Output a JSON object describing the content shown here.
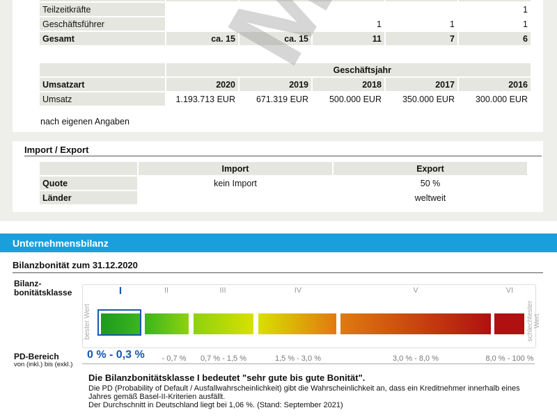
{
  "staff_table": {
    "rows": [
      {
        "label": "Teilzeitkräfte",
        "values": [
          "",
          "",
          "",
          "",
          "1"
        ]
      },
      {
        "label": "Geschäftsführer",
        "values": [
          "",
          "",
          "1",
          "1",
          "1"
        ]
      },
      {
        "label": "Gesamt",
        "values": [
          "ca. 15",
          "ca. 15",
          "11",
          "7",
          "6"
        ]
      }
    ]
  },
  "revenue_table": {
    "group_header": "Geschäftsjahr",
    "col_header": "Umsatzart",
    "years": [
      "2020",
      "2019",
      "2018",
      "2017",
      "2016"
    ],
    "row_label": "Umsatz",
    "values": [
      "1.193.713 EUR",
      "671.319 EUR",
      "500.000 EUR",
      "350.000 EUR",
      "300.000 EUR"
    ],
    "note": "nach eigenen Angaben"
  },
  "import_export": {
    "title": "Import / Export",
    "headers": [
      "Import",
      "Export"
    ],
    "rows": [
      {
        "label": "Quote",
        "import": "kein Import",
        "export": "50 %"
      },
      {
        "label": "Länder",
        "import": "",
        "export": "weltweit"
      }
    ]
  },
  "balance": {
    "section_title": "Unternehmensbilanz",
    "subtitle": "Bilanzbonität zum 31.12.2020",
    "class_label_1": "Bilanz-",
    "class_label_2": "bonitätsklasse",
    "classes": [
      "I",
      "II",
      "III",
      "IV",
      "V",
      "VI"
    ],
    "active_class": "I",
    "best_label": "bester Wert",
    "worst_label_1": "schlechtester",
    "worst_label_2": "Wert",
    "pd_title": "PD-Bereich",
    "pd_sub": "von (inkl.) bis (exkl.)",
    "pd_active": "0 % - 0,3 %",
    "pd_ranges": [
      "- 0,7 %",
      "0,7 % - 1,5 %",
      "1,5 % - 3,0 %",
      "3,0 % - 8,0 %",
      "8,0 % - 100 %"
    ],
    "bar_colors": [
      "#1e9a1e",
      "#3bb51e",
      "#8ed20e",
      "#d8e000",
      "#e07a10",
      "#b01010"
    ],
    "desc_title": "Die Bilanzbonitätsklasse I bedeutet \"sehr gute bis gute Bonität\".",
    "desc_lines": [
      "Die PD (Probability of Default / Ausfallwahrscheinlichkeit) gibt die Wahrscheinlichkeit an, dass ein Kreditnehmer innerhalb eines",
      "Jahres gemäß Basel-II-Kriterien ausfällt.",
      "Der Durchschnitt in Deutschland liegt bei 1,06 %. (Stand: September 2021)"
    ]
  },
  "watermark": "MUSTER CREFO"
}
